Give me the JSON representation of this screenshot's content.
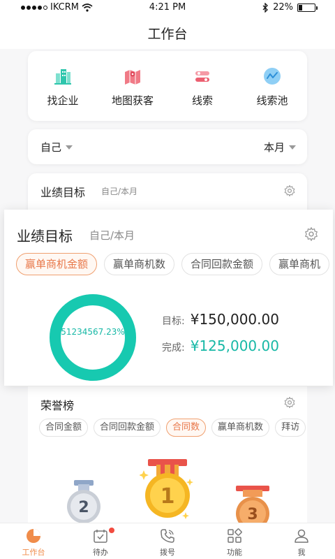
{
  "status_bar": {
    "carrier": "IKCRM",
    "time": "4:21 PM",
    "battery": "22%",
    "battery_level": 0.22
  },
  "header": {
    "title": "工作台"
  },
  "quick_actions": [
    {
      "label": "找企业",
      "icon": "building-icon"
    },
    {
      "label": "地图获客",
      "icon": "map-icon"
    },
    {
      "label": "线索",
      "icon": "lead-icon"
    },
    {
      "label": "线索池",
      "icon": "lead-pool-icon"
    }
  ],
  "filter": {
    "owner": "自己",
    "period": "本月"
  },
  "performance_bg": {
    "title": "业绩目标",
    "subtitle": "自己/本月"
  },
  "performance": {
    "title": "业绩目标",
    "subtitle": "自己/本月",
    "chips": [
      "赢单商机金额",
      "赢单商机数",
      "合同回款金额",
      "赢单商机"
    ],
    "active_chip": 0,
    "donut_label": "51234567.23%",
    "completion_ratio": 1.0,
    "target_label": "目标:",
    "target_value": "¥150,000.00",
    "done_label": "完成:",
    "done_value": "¥125,000.00",
    "accent_color": "#17c9b0"
  },
  "honor": {
    "title": "荣誉榜",
    "chips": [
      "合同金额",
      "合同回款金额",
      "合同数",
      "赢单商机数",
      "拜访"
    ],
    "active_chip": 2,
    "medals": [
      "2",
      "1",
      "3"
    ]
  },
  "tabbar": [
    {
      "label": "工作台",
      "icon": "dashboard-icon",
      "active": true
    },
    {
      "label": "待办",
      "icon": "todo-icon",
      "active": false,
      "badge": true
    },
    {
      "label": "拨号",
      "icon": "phone-icon",
      "active": false
    },
    {
      "label": "功能",
      "icon": "apps-icon",
      "active": false
    },
    {
      "label": "我",
      "icon": "profile-icon",
      "active": false
    }
  ]
}
